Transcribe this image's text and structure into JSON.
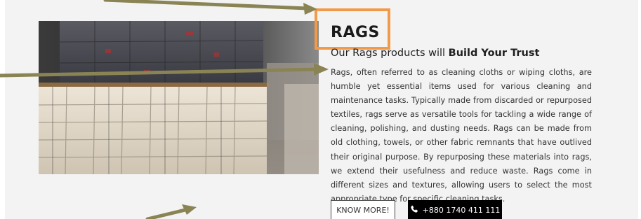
{
  "section": {
    "title": "RAGS",
    "subtitle_prefix": "Our Rags products will ",
    "subtitle_bold": "Build Your Trust",
    "description": "Rags, often referred to as cleaning cloths or wiping cloths, are humble yet essential items used for various cleaning and maintenance tasks. Typically made from discarded or repurposed textiles, rags serve as versatile tools for tackling a wide range of cleaning, polishing, and dusting needs. Rags can be made from old clothing, towels, or other fabric remnants that have outlived their original purpose. By repurposing these materials into rags, we extend their usefulness and reduce waste. Rags come in different sizes and textures, allowing users to select the most appropriate type for specific cleaning tasks."
  },
  "buttons": {
    "know_more": "KNOW MORE!",
    "phone": "+880 1740 411 111"
  },
  "icons": {
    "phone": "phone-icon"
  },
  "colors": {
    "highlight_box": "#f29a48",
    "annotation_arrow": "#8a8455",
    "phone_button_bg": "#000000"
  }
}
